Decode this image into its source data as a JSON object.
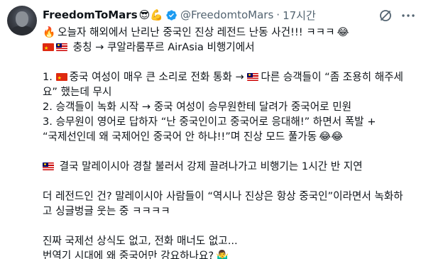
{
  "author": {
    "display_name": "FreedomToMars",
    "name_emojis": "😎💪",
    "handle": "@FreedomtoMars",
    "separator": "·",
    "time": "17시간"
  },
  "icons": {
    "verified": "verified-badge-icon",
    "grok": "grok-icon",
    "more": "more-icon",
    "fire": "fire-icon",
    "laugh": "laughing-tears-icon",
    "shrug": "person-shrugging-icon"
  },
  "colors": {
    "verified_blue": "#1d9bf0",
    "secondary_text": "#536471"
  },
  "body": {
    "l1": "오늘자 해외에서 난리난 중국인 진상 레전드 난동 사건!!! ㅋㅋㅋ",
    "l2": "충칭 → 쿠알라룸푸르 AirAsia 비행기에서",
    "l4a": "1.",
    "l4b": "중국 여성이 매우 큰 소리로 전화 통화 →",
    "l4c": "다른 승객들이 “좀 조용히 해주세",
    "l5": "요” 했는데 무시",
    "l6": "2. 승객들이 녹화 시작 → 중국 여성이 승무원한테 달려가 중국어로 민원",
    "l7": "3. 승무원이 영어로 답하자 “난 중국인이고 중국어로 응대해!” 하면서 폭발 +",
    "l8": "“국제선인데 왜 국제어인 중국어 안 하냐!!”며 진상 모드 풀가동",
    "l10": "결국 말레이시아 경찰 불러서 강제 끌려나가고 비행기는 1시간 반 지연",
    "l12": "더 레전드인 건? 말레이시아 사람들이 “역시나 진상은 항상 중국인”이라면서 녹화하",
    "l13": "고 싱글벙글 웃는 중 ㅋㅋㅋㅋ",
    "l15": "진짜 국제선 상식도 없고, 전화 매너도 없고...",
    "l16": "번역기 시대에 왜 중국어만 강요하나요?",
    "emoji_fire": "🔥",
    "emoji_laugh": "😂",
    "emoji_laugh2": "😂😂",
    "emoji_shrug": "🤷‍♂️"
  }
}
